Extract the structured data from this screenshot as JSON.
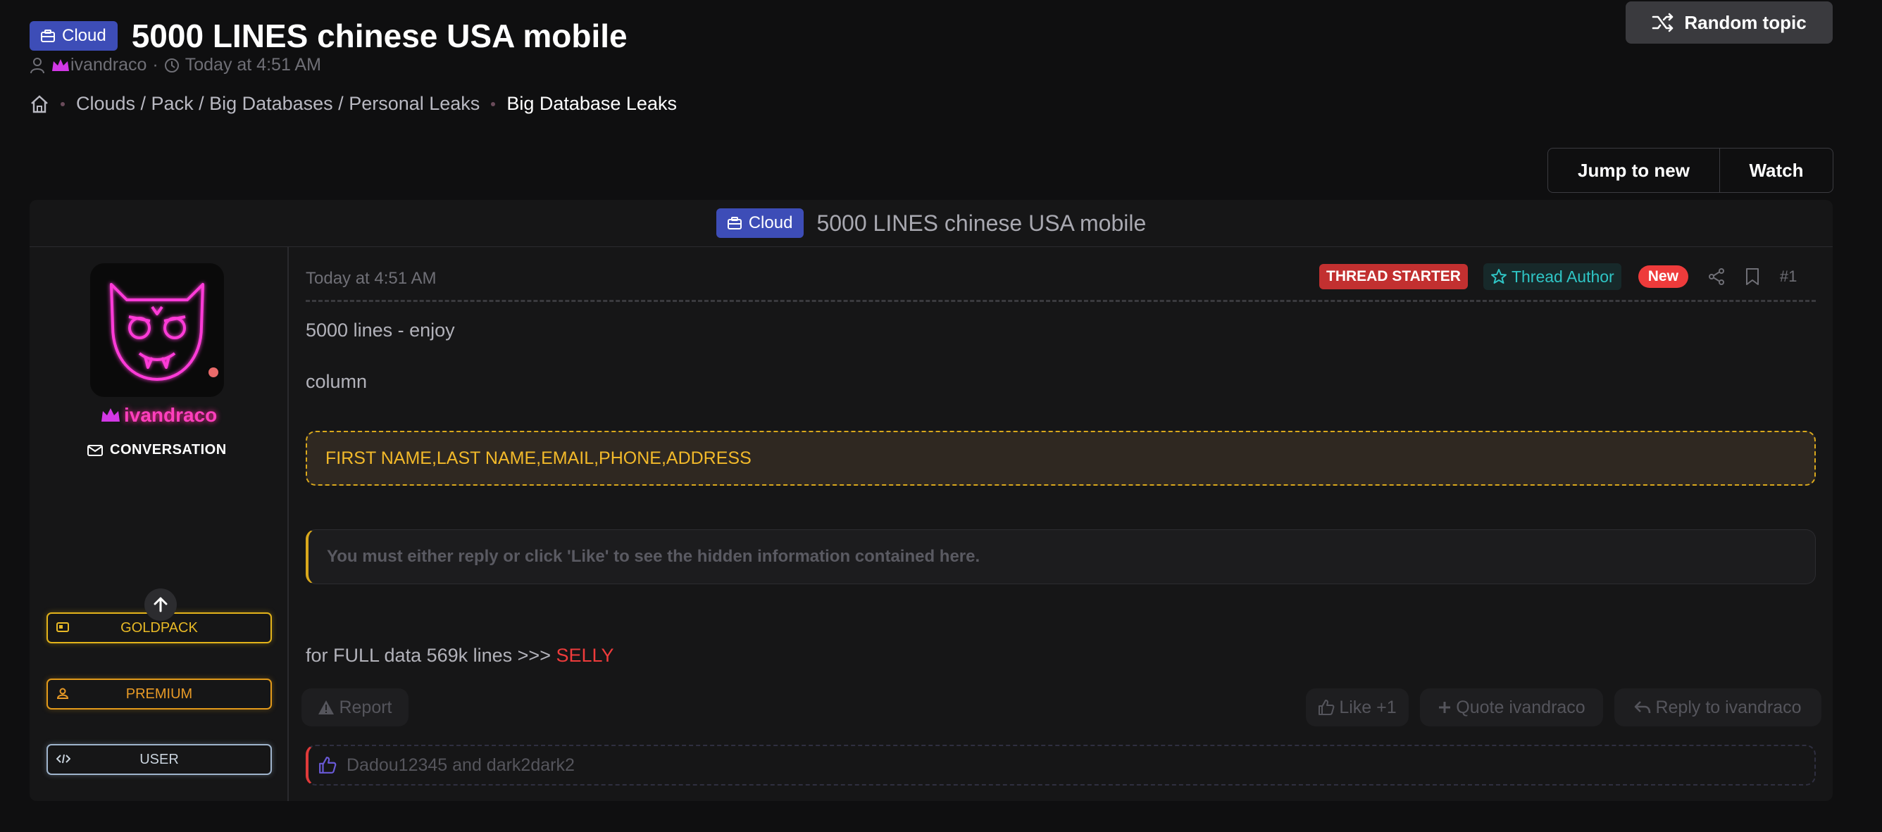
{
  "header": {
    "prefix_label": "Cloud",
    "title": "5000 LINES chinese USA mobile",
    "author": "ivandraco",
    "separator": "·",
    "timestamp": "Today at 4:51 AM"
  },
  "breadcrumbs": [
    {
      "label": "Clouds / Pack / Big Databases / Personal Leaks"
    },
    {
      "label": "Big Database Leaks"
    }
  ],
  "actions": {
    "random_topic": "Random topic",
    "jump_to_new": "Jump to new",
    "watch": "Watch"
  },
  "panel": {
    "prefix_label": "Cloud",
    "title": "5000 LINES chinese USA mobile"
  },
  "user": {
    "name": "ivandraco",
    "conversation": "CONVERSATION",
    "roles": [
      "GOLDPACK",
      "PREMIUM",
      "USER"
    ]
  },
  "post": {
    "date": "Today at 4:51 AM",
    "tag_starter": "THREAD STARTER",
    "tag_author": "Thread Author",
    "tag_new": "New",
    "number": "#1",
    "line1": "5000 lines - enjoy",
    "line2": "column",
    "code": "FIRST NAME,LAST NAME,EMAIL,PHONE,ADDRESS",
    "hidden": "You must either reply or click 'Like' to see the hidden information contained here.",
    "full_prefix": "for FULL data 569k lines >>> ",
    "full_link": "SELLY",
    "report": "Report",
    "like": "Like +1",
    "quote": "Quote ivandraco",
    "reply": "Reply to ivandraco",
    "likes_by": "Dadou12345 and dark2dark2"
  },
  "colors": {
    "accent_blue": "#3d4db7",
    "username_pink": "#ff3fbd",
    "gold": "#e3b31a",
    "danger_red": "#ee3b3b",
    "teal": "#2fc5c5"
  }
}
